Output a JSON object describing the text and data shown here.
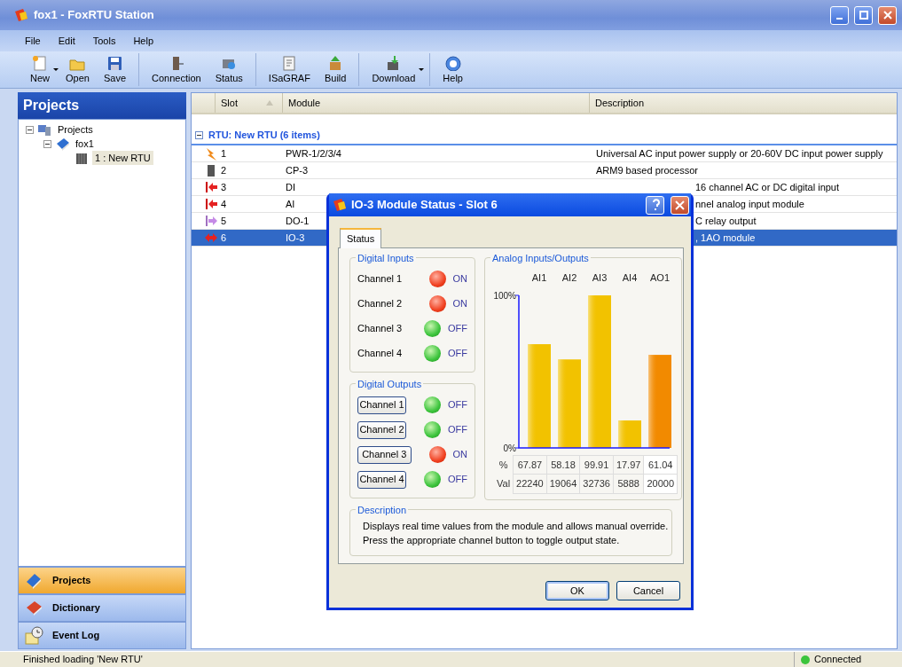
{
  "window": {
    "title": "fox1 - FoxRTU Station"
  },
  "menu": [
    "File",
    "Edit",
    "Tools",
    "Help"
  ],
  "toolbar": [
    [
      {
        "label": "New",
        "kind": "new",
        "dropdown": true
      },
      {
        "label": "Open",
        "kind": "open",
        "dropdown": false
      },
      {
        "label": "Save",
        "kind": "save",
        "dropdown": false
      }
    ],
    [
      {
        "label": "Connection",
        "kind": "connection",
        "dropdown": false
      },
      {
        "label": "Status",
        "kind": "status",
        "dropdown": false
      }
    ],
    [
      {
        "label": "ISaGRAF",
        "kind": "isagraf",
        "dropdown": false
      },
      {
        "label": "Build",
        "kind": "build",
        "dropdown": false
      }
    ],
    [
      {
        "label": "Download",
        "kind": "download",
        "dropdown": true
      }
    ],
    [
      {
        "label": "Help",
        "kind": "help",
        "dropdown": false
      }
    ]
  ],
  "sidebar": {
    "title": "Projects",
    "tree": [
      {
        "label": "Projects",
        "kind": "computer",
        "expanded": true,
        "selected": false,
        "children": [
          {
            "label": "fox1",
            "kind": "book",
            "expanded": true,
            "selected": false,
            "children": [
              {
                "label": "1 : New RTU",
                "kind": "rtu",
                "selected": true
              }
            ]
          }
        ]
      }
    ],
    "nav": [
      {
        "label": "Projects",
        "kind": "projects",
        "selected": true
      },
      {
        "label": "Dictionary",
        "kind": "dictionary",
        "selected": false
      },
      {
        "label": "Event Log",
        "kind": "eventlog",
        "selected": false
      }
    ]
  },
  "table": {
    "columns": [
      {
        "label": "Slot",
        "sorted": true
      },
      {
        "label": "Module",
        "sorted": false
      },
      {
        "label": "Description",
        "sorted": false
      }
    ],
    "group": {
      "label": "RTU: New RTU (6 items)",
      "expanded": true
    },
    "rows": [
      {
        "slot": "1",
        "module": "PWR-1/2/3/4",
        "description": "Universal AC input power supply or 20-60V DC input power supply",
        "kind": "power",
        "selected": false
      },
      {
        "slot": "2",
        "module": "CP-3",
        "description": "ARM9 based processor",
        "kind": "processor",
        "selected": false
      },
      {
        "slot": "3",
        "module": "DI",
        "description": "16 channel AC or DC digital input",
        "kind": "input",
        "selected": false
      },
      {
        "slot": "4",
        "module": "AI",
        "description": "nnel analog input module",
        "kind": "input",
        "selected": false
      },
      {
        "slot": "5",
        "module": "DO-1",
        "description": "C relay output",
        "kind": "output",
        "selected": false
      },
      {
        "slot": "6",
        "module": "IO-3",
        "description": ", 1AO module",
        "kind": "io",
        "selected": true
      }
    ]
  },
  "dialog": {
    "title": "IO-3 Module Status - Slot 6",
    "tabs": [
      {
        "label": "Status",
        "selected": true
      }
    ],
    "digital_inputs": {
      "title": "Digital Inputs",
      "channels": [
        {
          "label": "Channel 1",
          "on": true,
          "state": "ON"
        },
        {
          "label": "Channel 2",
          "on": true,
          "state": "ON"
        },
        {
          "label": "Channel 3",
          "on": false,
          "state": "OFF"
        },
        {
          "label": "Channel 4",
          "on": false,
          "state": "OFF"
        }
      ]
    },
    "digital_outputs": {
      "title": "Digital Outputs",
      "channels": [
        {
          "label": "Channel 1",
          "on": false,
          "state": "OFF"
        },
        {
          "label": "Channel 2",
          "on": false,
          "state": "OFF"
        },
        {
          "label": "Channel 3",
          "on": true,
          "state": "ON"
        },
        {
          "label": "Channel 4",
          "on": false,
          "state": "OFF"
        }
      ]
    },
    "analog": {
      "title": "Analog Inputs/Outputs",
      "chart_data": {
        "type": "bar",
        "categories": [
          "AI1",
          "AI2",
          "AI3",
          "AI4",
          "AO1"
        ],
        "stacked": true,
        "series": [
          {
            "color": "#f2c200",
            "values": [
              68,
              58,
              100,
              18,
              null
            ]
          },
          {
            "color": "#f28a00",
            "values": [
              null,
              null,
              null,
              null,
              61
            ]
          }
        ],
        "ylim": [
          0,
          100
        ],
        "yticks": [
          {
            "value": 0,
            "label": "0%"
          },
          {
            "value": 100,
            "label": "100%"
          }
        ]
      },
      "readings": [
        {
          "label": "%",
          "values": [
            "67.87",
            "58.18",
            "99.91",
            "17.97",
            "61.04"
          ]
        },
        {
          "label": "Val",
          "values": [
            "22240",
            "19064",
            "32736",
            "5888",
            "20000"
          ]
        }
      ],
      "editable": [
        false,
        false,
        false,
        false,
        true
      ]
    },
    "description": {
      "title": "Description",
      "lines": [
        "Displays real time values from the module and allows manual override.",
        "Press the appropriate channel button to toggle output state."
      ]
    },
    "buttons": [
      {
        "label": "OK",
        "default": true
      },
      {
        "label": "Cancel",
        "default": false
      }
    ]
  },
  "status_bar": {
    "message": "Finished loading 'New RTU'",
    "connection": "Connected",
    "connected": true
  }
}
